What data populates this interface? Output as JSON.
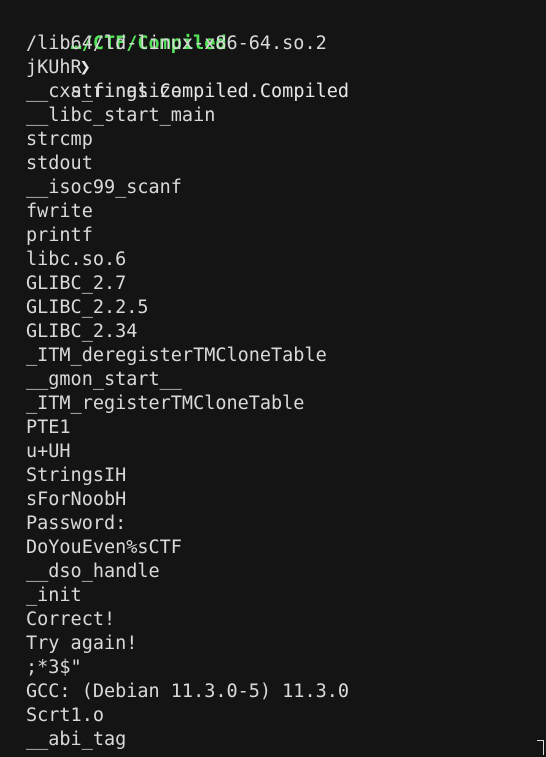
{
  "prompt": {
    "path": "…/CTF/Compiled",
    "arrow": "❯",
    "command": "strings Compiled.Compiled"
  },
  "output_lines": [
    "/lib64/ld-linux-x86-64.so.2",
    "jKUhR",
    "__cxa_finalize",
    "__libc_start_main",
    "strcmp",
    "stdout",
    "__isoc99_scanf",
    "fwrite",
    "printf",
    "libc.so.6",
    "GLIBC_2.7",
    "GLIBC_2.2.5",
    "GLIBC_2.34",
    "_ITM_deregisterTMCloneTable",
    "__gmon_start__",
    "_ITM_registerTMCloneTable",
    "PTE1",
    "u+UH",
    "StringsIH",
    "sForNoobH",
    "Password:",
    "DoYouEven%sCTF",
    "__dso_handle",
    "_init",
    "Correct!",
    "Try again!",
    ";*3$\"",
    "GCC: (Debian 11.3.0-5) 11.3.0",
    "Scrt1.o",
    "__abi_tag"
  ],
  "colors": {
    "background": "#141414",
    "prompt_path": "#55e35a",
    "text": "#d9d9d9"
  },
  "icons": {
    "cursor": "text-cursor-icon"
  }
}
